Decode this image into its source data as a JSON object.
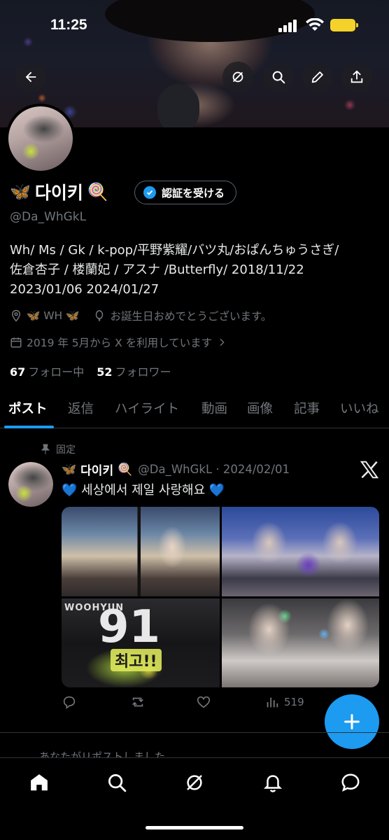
{
  "status_bar": {
    "time": "11:25"
  },
  "profile": {
    "name_prefix_emoji": "🦋",
    "name": "다이키",
    "name_suffix_emoji": "🍭",
    "verify_button": "認証を受ける",
    "handle": "@Da_WhGkL",
    "bio_lines": [
      "Wh/ Ms / Gk / k-pop/平野紫耀/バツ丸/おぱんちゅうさぎ/",
      "佐倉杏子 / 楼蘭妃 / アスナ /Butterfly/ 2018/11/22",
      "2023/01/06 2024/01/27"
    ],
    "location": "🦋 WH 🦋",
    "birthday": "お誕生日おめでとうございます。",
    "joined": "2019 年 5月から X を利用しています",
    "following_count": "67",
    "following_label": "フォロー中",
    "followers_count": "52",
    "followers_label": "フォロワー"
  },
  "tabs": [
    "ポスト",
    "返信",
    "ハイライト",
    "動画",
    "画像",
    "記事",
    "いいね"
  ],
  "active_tab": "ポスト",
  "post": {
    "pinned_label": "固定",
    "author_emoji": "🦋",
    "author_name": "다이키",
    "author_emoji2": "🍭",
    "meta": "@Da_WhGkL · 2024/02/01",
    "text": "💙 세상에서 제일 사랑해요 💙",
    "image_texts": {
      "banner": "WOOHYUN",
      "number": "91",
      "sign": "최고!!"
    },
    "views": "519"
  },
  "repost_note": "あなたがリポストしました",
  "colors": {
    "accent": "#1d9bf0",
    "background": "#000000",
    "muted": "#71767b"
  }
}
